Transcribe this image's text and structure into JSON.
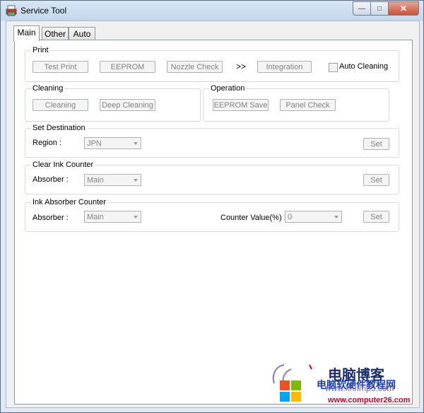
{
  "window": {
    "title": "Service Tool",
    "minimize_icon": "minimize-icon",
    "maximize_icon": "maximize-icon",
    "close_icon": "close-icon"
  },
  "tabs": [
    "Main",
    "Other",
    "Auto"
  ],
  "print": {
    "label": "Print",
    "test_print": "Test Print",
    "eeprom": "EEPROM",
    "nozzle_check": "Nozzle Check",
    "arrows": ">>",
    "integration": "Integration",
    "auto_cleaning": "Auto Cleaning"
  },
  "cleaning": {
    "label": "Cleaning",
    "cleaning_btn": "Cleaning",
    "deep_cleaning": "Deep Cleaning"
  },
  "operation": {
    "label": "Operation",
    "eeprom_save": "EEPROM Save",
    "panel_check": "Panel Check"
  },
  "set_destination": {
    "label": "Set Destination",
    "region_label": "Region :",
    "region_value": "JPN",
    "set": "Set"
  },
  "clear_ink_counter": {
    "label": "Clear Ink Counter",
    "absorber_label": "Absorber :",
    "absorber_value": "Main",
    "set": "Set"
  },
  "ink_absorber_counter": {
    "label": "Ink Absorber Counter",
    "absorber_label": "Absorber :",
    "absorber_value": "Main",
    "counter_label": "Counter Value(%) :",
    "counter_value": "0",
    "set": "Set"
  },
  "watermark": {
    "line1": "电脑博客",
    "line2": "电脑软硬件教程网",
    "line3": "www.knhmp3.com",
    "line4": "www.computer26.com"
  }
}
